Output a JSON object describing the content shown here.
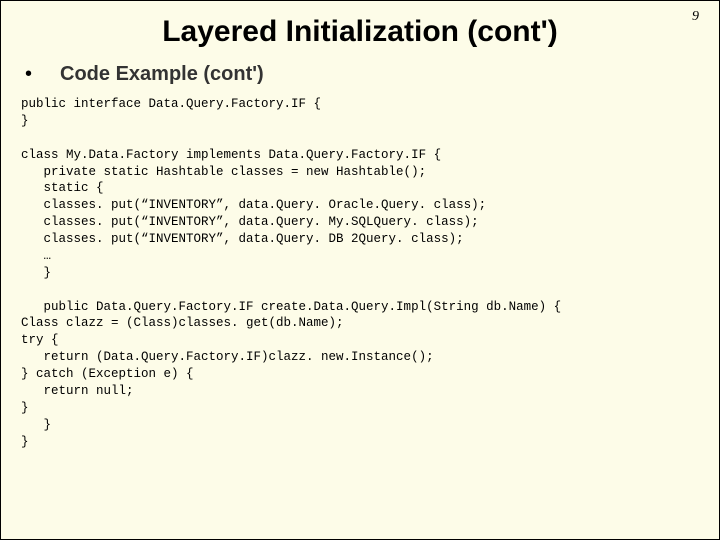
{
  "slide": {
    "page_number": "9",
    "title": "Layered Initialization (cont')",
    "bullet_symbol": "•",
    "subtitle": "Code Example (cont')",
    "code": "public interface Data.Query.Factory.IF {\n}\n\nclass My.Data.Factory implements Data.Query.Factory.IF {\n   private static Hashtable classes = new Hashtable();\n   static {\n   classes. put(“INVENTORY”, data.Query. Oracle.Query. class);\n   classes. put(“INVENTORY”, data.Query. My.SQLQuery. class);\n   classes. put(“INVENTORY”, data.Query. DB 2Query. class);\n   …\n   }\n\n   public Data.Query.Factory.IF create.Data.Query.Impl(String db.Name) {\nClass clazz = (Class)classes. get(db.Name);\ntry {\n   return (Data.Query.Factory.IF)clazz. new.Instance();\n} catch (Exception e) {\n   return null;\n}\n   }\n}"
  }
}
